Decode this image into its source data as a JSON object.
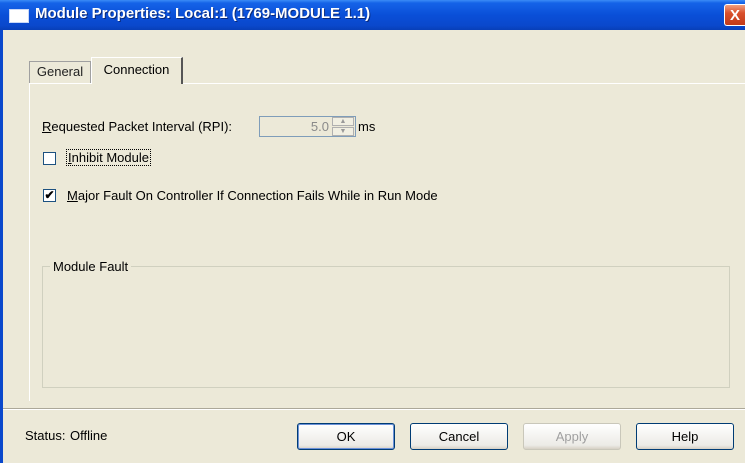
{
  "window": {
    "title": "Module Properties: Local:1 (1769-MODULE 1.1)",
    "close_glyph": "X"
  },
  "tabs": [
    {
      "label": "General",
      "active": false
    },
    {
      "label": "Connection",
      "active": true
    }
  ],
  "connection": {
    "rpi_label_u": "R",
    "rpi_label_rest": "equested Packet Interval (RPI):",
    "rpi_value": "5.0",
    "rpi_unit": "ms",
    "inhibit_u": "I",
    "inhibit_rest": "nhibit Module",
    "inhibit_checked": false,
    "major_fault_u": "M",
    "major_fault_rest": "ajor Fault On Controller If Connection Fails While in Run Mode",
    "major_fault_checked": true,
    "check_glyph": "✔",
    "module_fault_title": "Module Fault"
  },
  "footer": {
    "status_label": "Status:",
    "status_value": "Offline",
    "ok_label": "OK",
    "cancel_label": "Cancel",
    "apply_label": "Apply",
    "help_label": "Help"
  },
  "colors": {
    "titlebar": "#0a4fd8",
    "dialog_bg": "#ece9d8",
    "close_button": "#d9502c"
  },
  "icons": {
    "window_icon": "window-icon",
    "spin_up": "▲",
    "spin_down": "▼"
  }
}
